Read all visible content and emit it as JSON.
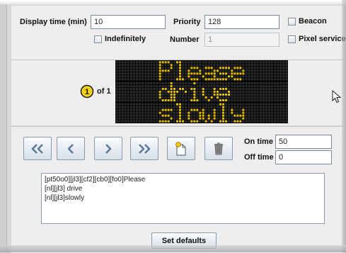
{
  "colors": {
    "panel_bg": "#eeeeee",
    "sign_bg": "#060606",
    "led_on": "#e6c000",
    "led_off": "#2b2b2b",
    "button_icon": "#5f7a98"
  },
  "form": {
    "display_time_label": "Display time (min)",
    "display_time_value": "10",
    "priority_label": "Priority",
    "priority_value": "128",
    "beacon_label": "Beacon",
    "beacon_checked": false,
    "indefinitely_label": "Indefinitely",
    "indefinitely_checked": false,
    "number_label": "Number",
    "number_value": "1",
    "pixel_service_label": "Pixel service",
    "pixel_service_checked": false
  },
  "page_indicator": {
    "current": "1",
    "of_label": "of 1"
  },
  "sign": {
    "lines": [
      "Please",
      "drive",
      "slowly"
    ],
    "rows": 3,
    "cols": 12
  },
  "toolbar": [
    {
      "name": "first-page-button",
      "icon": "double-chevron-left-icon"
    },
    {
      "name": "previous-page-button",
      "icon": "chevron-left-icon"
    },
    {
      "name": "next-page-button",
      "icon": "chevron-right-icon"
    },
    {
      "name": "last-page-button",
      "icon": "double-chevron-right-icon"
    },
    {
      "name": "new-page-button",
      "icon": "new-page-icon"
    },
    {
      "name": "delete-page-button",
      "icon": "trash-icon"
    }
  ],
  "timing": {
    "on_time_label": "On time",
    "on_time_value": "50",
    "off_time_label": "Off time",
    "off_time_value": "0"
  },
  "multi_text": [
    "[pt50o0][jl3][cf2][cb0][fo0]Please",
    "[nl][jl3] drive",
    "[nl][jl3]slowly"
  ],
  "actions": {
    "set_defaults_label": "Set defaults"
  }
}
